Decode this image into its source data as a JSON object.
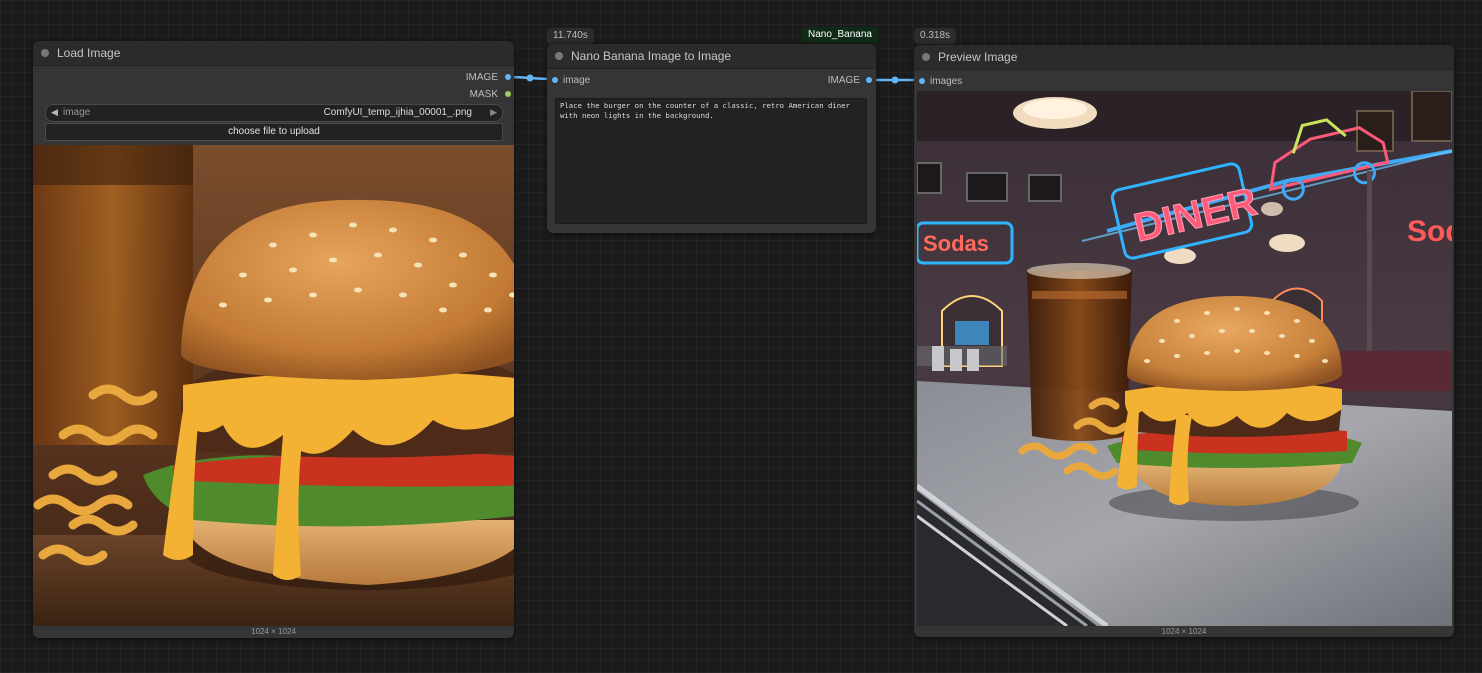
{
  "load_image": {
    "title": "Load Image",
    "outputs": [
      "IMAGE",
      "MASK"
    ],
    "image_widget_label": "image",
    "image_widget_value": "ComfyUI_temp_ijhia_00001_.png",
    "upload_button": "choose file to upload",
    "dims": "1024 × 1024"
  },
  "nano_node": {
    "time_badge": "11.740s",
    "tag": "Nano_Banana",
    "title": "Nano Banana Image to Image",
    "input_label": "image",
    "output_label": "IMAGE",
    "prompt": "Place the burger on the counter of a classic, retro American diner\nwith neon lights in the background."
  },
  "preview": {
    "time_badge": "0.318s",
    "title": "Preview Image",
    "input_label": "images",
    "dims": "1024 × 1024",
    "neon_text": "DINER",
    "neon_text_2": "Sodas",
    "neon_text_3": "Sod"
  },
  "colors": {
    "link": "#64b5f6",
    "mask_dot": "#9ccc65"
  }
}
